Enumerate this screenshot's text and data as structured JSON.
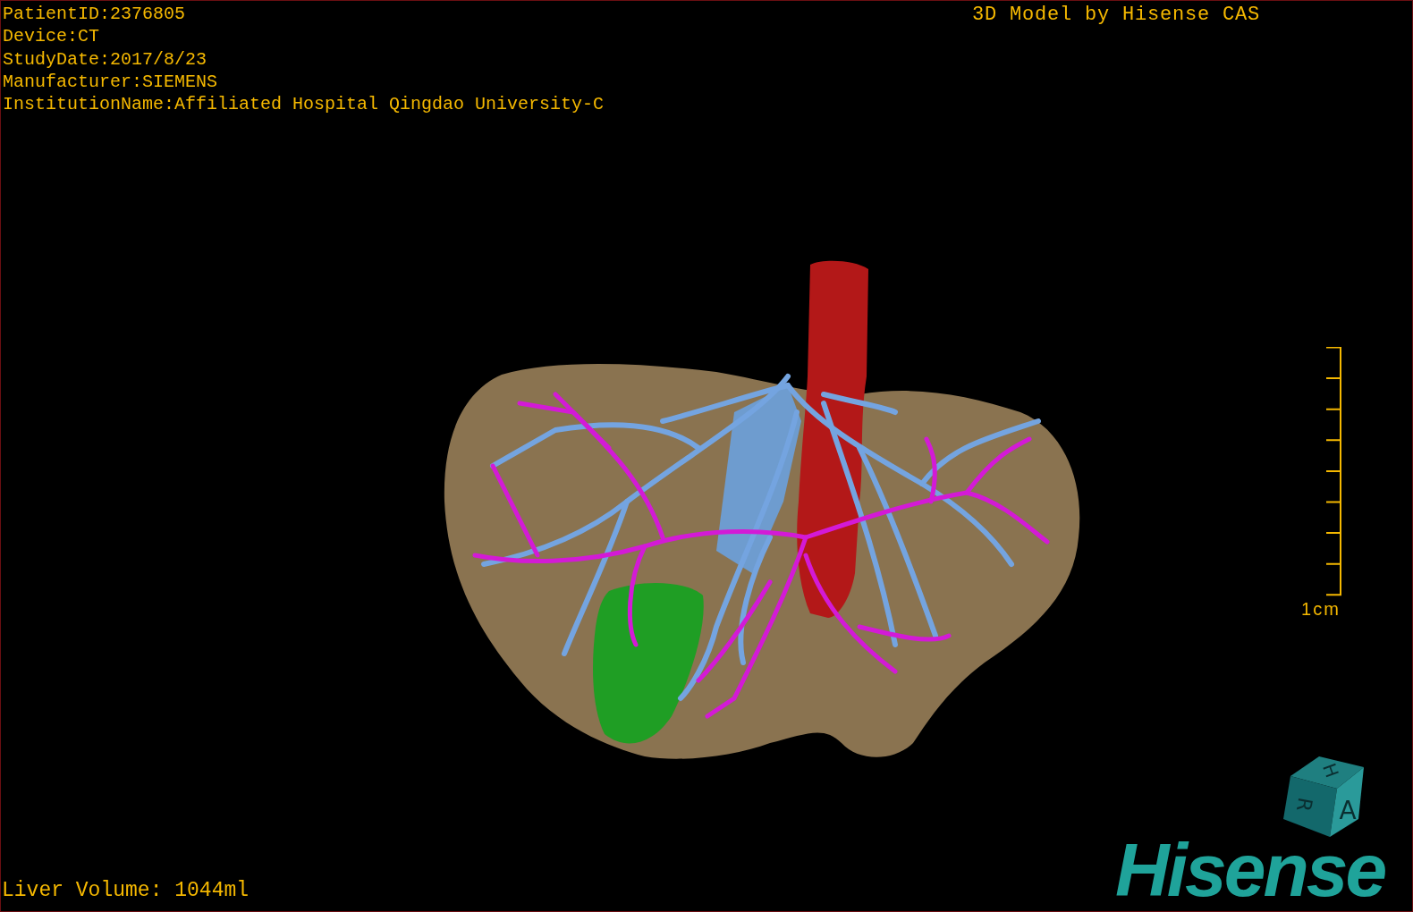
{
  "info_lines": [
    "PatientID:2376805",
    "Device:CT",
    "StudyDate:2017/8/23",
    "Manufacturer:SIEMENS",
    "InstitutionName:Affiliated Hospital Qingdao University-C"
  ],
  "title": "3D Model by Hisense CAS",
  "scale_bar": {
    "label": "1cm"
  },
  "orientation_cube": {
    "faces": [
      "H",
      "R",
      "A"
    ]
  },
  "logo": "Hisense",
  "volume": "Liver Volume: 1044ml"
}
